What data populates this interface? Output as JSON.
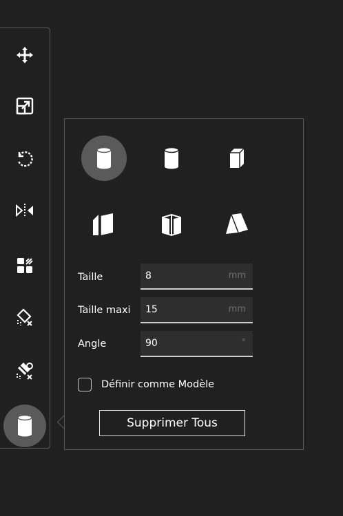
{
  "toolbar": {
    "tools": [
      {
        "name": "move-icon"
      },
      {
        "name": "scale-icon"
      },
      {
        "name": "rotate-icon"
      },
      {
        "name": "mirror-icon"
      },
      {
        "name": "arrange-icon"
      },
      {
        "name": "support-paint-icon"
      },
      {
        "name": "support-blocker-icon"
      },
      {
        "name": "support-cylinder-icon",
        "active": true
      }
    ]
  },
  "panel": {
    "shapes": [
      {
        "name": "cylinder-shape-icon",
        "selected": true
      },
      {
        "name": "tube-shape-icon"
      },
      {
        "name": "cuboid-shape-icon"
      },
      {
        "name": "line-wall-shape-icon"
      },
      {
        "name": "cross-wall-shape-icon"
      },
      {
        "name": "wedge-shape-icon"
      }
    ],
    "size_label": "Taille",
    "size_value": "8",
    "size_unit": "mm",
    "max_size_label": "Taille maxi",
    "max_size_value": "15",
    "max_size_unit": "mm",
    "angle_label": "Angle",
    "angle_value": "90",
    "angle_unit": "°",
    "set_default_label": "Définir comme Modèle",
    "set_default_checked": false,
    "delete_all_label": "Supprimer Tous"
  },
  "colors": {
    "background": "#202020",
    "border": "#5a5a5a",
    "selected": "#5a5a5a",
    "field": "#2e2e2e",
    "text": "#ffffff"
  }
}
